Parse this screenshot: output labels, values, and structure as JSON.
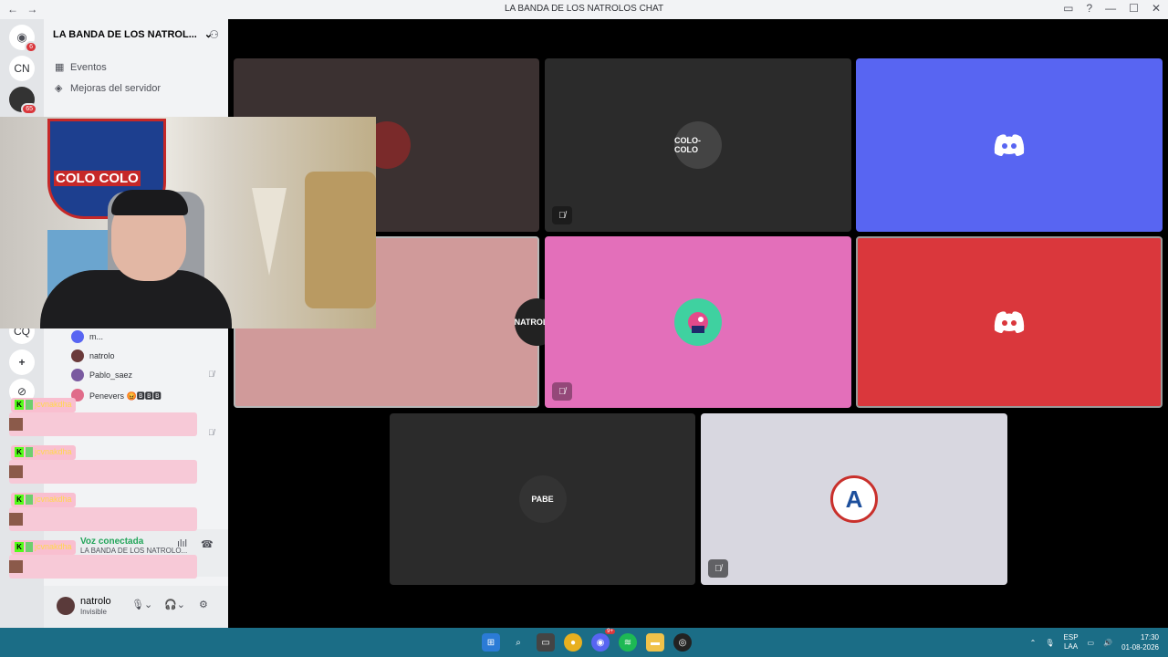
{
  "window": {
    "title": "LA BANDA DE LOS NATROLOS CHAT",
    "back": "←",
    "forward": "→",
    "controls": [
      "▭",
      "?",
      "—",
      "☐",
      "✕"
    ]
  },
  "servers": [
    {
      "label": "",
      "badge": "6"
    },
    {
      "label": "CN",
      "badge": ""
    },
    {
      "label": "",
      "badge": "65"
    },
    {
      "label": "CQ",
      "badge": ""
    }
  ],
  "channels": {
    "server_name": "LA BANDA DE LOS NATROL...",
    "items": [
      {
        "label": "Eventos",
        "icon": "calendar-icon"
      },
      {
        "label": "Mejoras del servidor",
        "icon": "boost-icon"
      }
    ],
    "voice_users": [
      {
        "name": "m...",
        "muted": false,
        "color": "#5865f2"
      },
      {
        "name": "natrolo",
        "muted": false,
        "color": "#6b3a3a"
      },
      {
        "name": "Pablo_saez",
        "muted": true,
        "color": "#7a5aa0"
      },
      {
        "name": "Penevers 😡🅱🅱🅱",
        "muted": false,
        "color": "#e06c8a"
      }
    ]
  },
  "overlay": {
    "rows": [
      {
        "name": "jcvnakdha"
      },
      {
        "name": "jcvnakdha"
      },
      {
        "name": "jcvnakdha"
      },
      {
        "name": "jcvnakdha"
      }
    ]
  },
  "voice": {
    "status": "Voz conectada",
    "channel": "LA BANDA DE LOS NATROLO..."
  },
  "user": {
    "name": "natrolo",
    "status": "Invisible"
  },
  "tiles": [
    {
      "bg": "#3b3131",
      "avatar": "",
      "avatar_bg": "#7a2a2a",
      "muted": false,
      "logo": false
    },
    {
      "bg": "#2b2b2b",
      "avatar": "COLO-COLO",
      "avatar_bg": "#444",
      "muted": true,
      "logo": false
    },
    {
      "bg": "#5865f2",
      "avatar": "",
      "avatar_bg": "",
      "muted": false,
      "logo": true
    },
    {
      "bg": "#d09a9a",
      "avatar": "NATROLOS",
      "avatar_bg": "#222",
      "muted": false,
      "logo": false
    },
    {
      "bg": "#e36fba",
      "avatar": "",
      "avatar_bg": "#3fd1a0",
      "muted": true,
      "logo": false
    },
    {
      "bg": "#da373c",
      "avatar": "",
      "avatar_bg": "",
      "muted": false,
      "logo": true
    },
    {
      "bg": "#2b2b2b",
      "avatar": "PABE",
      "avatar_bg": "#333",
      "muted": false,
      "logo": false
    },
    {
      "bg": "#d8d7e0",
      "avatar": "A",
      "avatar_bg": "#ffffff",
      "muted": true,
      "logo": false
    }
  ],
  "camera": {
    "sign_text": "COLO COLO"
  },
  "taskbar": {
    "lang": "ESP",
    "lang2": "LAA",
    "time": "17:30",
    "date": "01-08-2026",
    "discord_badge": "9+"
  }
}
